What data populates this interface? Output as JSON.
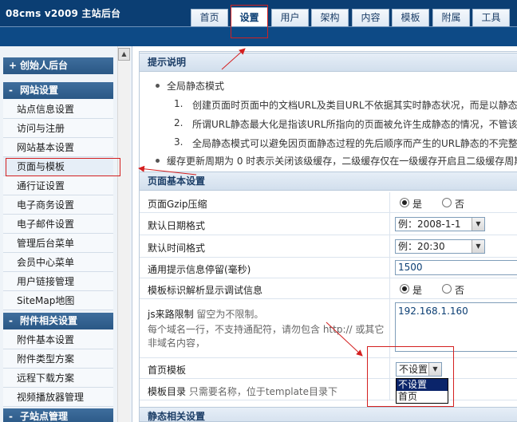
{
  "header": {
    "brand": "08cms  v2009  主站后台",
    "tabs": [
      "首页",
      "设置",
      "用户",
      "架构",
      "内容",
      "模板",
      "附属",
      "工具"
    ],
    "active_tab": "设置"
  },
  "sidebar": {
    "sections": [
      {
        "sign": "+",
        "title": "创始人后台"
      },
      {
        "sign": "-",
        "title": "网站设置"
      },
      {
        "sign": "-",
        "title": "附件相关设置"
      },
      {
        "sign": "-",
        "title": "子站点管理"
      }
    ],
    "site_settings_items": [
      "站点信息设置",
      "访问与注册",
      "网站基本设置",
      "页面与模板",
      "通行证设置",
      "电子商务设置",
      "电子邮件设置",
      "管理后台菜单",
      "会员中心菜单",
      "用户链接管理",
      "SiteMap地图"
    ],
    "attachment_items": [
      "附件基本设置",
      "附件类型方案",
      "远程下载方案",
      "视频播放器管理"
    ],
    "selected_item": "页面与模板"
  },
  "tips": {
    "title": "提示说明",
    "bullet1": "全局静态模式",
    "items": [
      {
        "num": "1.",
        "text": "创建页面时页面中的文档URL及类目URL不依据其实时静态状况，而是以静态"
      },
      {
        "num": "2.",
        "text": "所谓URL静态最大化是指该URL所指向的页面被允许生成静态的情况，不管该"
      },
      {
        "num": "3.",
        "text": "全局静态模式可以避免因页面静态过程的先后顺序而产生的URL静态的不完整"
      }
    ],
    "bullet2": "缓存更新周期为 0 时表示关闭该级缓存，二级缓存仅在一级缓存开启且二级缓存周期"
  },
  "page_settings": {
    "title": "页面基本设置",
    "gzip": {
      "label": "页面Gzip压缩",
      "yes": "是",
      "no": "否",
      "value": "是"
    },
    "date_format": {
      "label": "默认日期格式",
      "value": "例：2008-1-1"
    },
    "time_format": {
      "label": "默认时间格式",
      "value": "例：20:30"
    },
    "notice_pause": {
      "label": "通用提示信息停留(毫秒)",
      "value": "1500"
    },
    "tpl_debug": {
      "label": "模板标识解析显示调试信息",
      "yes": "是",
      "no": "否",
      "value": "是"
    },
    "js_source": {
      "label": "js来路限制",
      "hint": "留空为不限制。",
      "desc1": "每个域名一行，不支持通配符，请勿包含  http:// 或其它",
      "desc2": "非域名内容，",
      "value": "192.168.1.160"
    },
    "home_template": {
      "label": "首页模板",
      "value": "不设置",
      "options": [
        "不设置",
        "首页"
      ]
    },
    "template_dir": {
      "label": "模板目录",
      "hint": "只需要名称，位于template目录下"
    }
  },
  "static_settings": {
    "title": "静态相关设置"
  },
  "colors": {
    "header_bg": "#0b3e73",
    "annotation": "#d42020",
    "selection": "#0a246a"
  }
}
